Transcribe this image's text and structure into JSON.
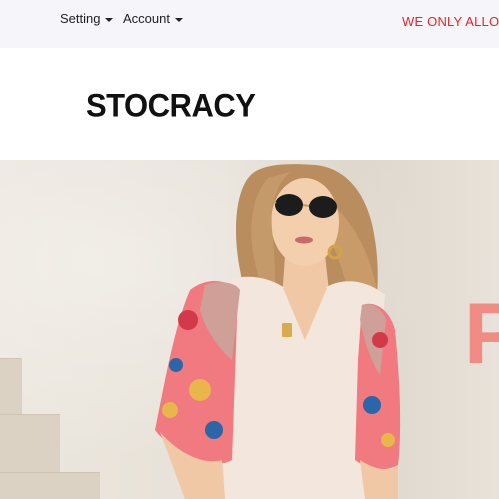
{
  "topbar": {
    "setting_label": "Setting",
    "account_label": "Account",
    "promo_text": "WE ONLY ALLOW"
  },
  "header": {
    "logo_text": "STOCRACY"
  },
  "hero": {
    "letter": "P"
  },
  "colors": {
    "promo": "#e0262b",
    "hero_letter": "#f08c83",
    "topbar_bg": "#f5f5fa"
  }
}
